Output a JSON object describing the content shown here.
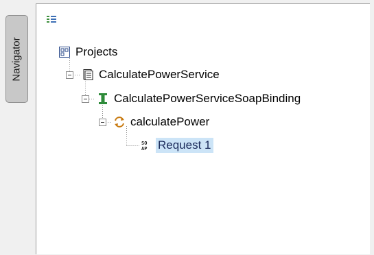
{
  "sidebar": {
    "tab_label": "Navigator"
  },
  "toolbar": {
    "icon": "list-view-icon"
  },
  "tree": {
    "root": {
      "label": "Projects",
      "icon": "projects-icon"
    },
    "service": {
      "label": "CalculatePowerService",
      "icon": "service-document-icon"
    },
    "binding": {
      "label": "CalculatePowerServiceSoapBinding",
      "icon": "binding-icon"
    },
    "operation": {
      "label": "calculatePower",
      "icon": "operation-icon"
    },
    "request": {
      "label": "Request 1",
      "icon": "soap-request-icon",
      "selected": true
    }
  },
  "colors": {
    "selection": "#cce4f7",
    "binding_icon": "#2e8b3a",
    "operation_icon": "#c87a10"
  }
}
